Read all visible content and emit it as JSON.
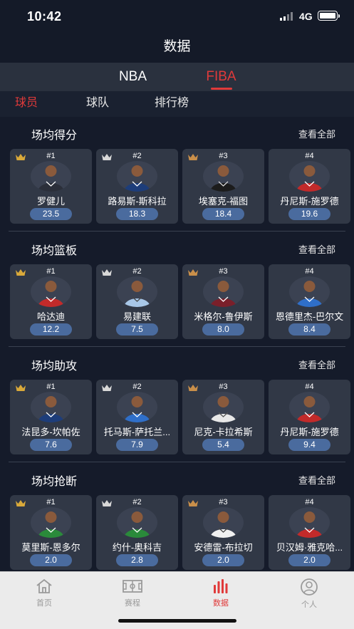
{
  "status": {
    "time": "10:42",
    "network": "4G"
  },
  "header": {
    "title": "数据"
  },
  "league_tabs": [
    {
      "label": "NBA",
      "active": false
    },
    {
      "label": "FIBA",
      "active": true
    }
  ],
  "sub_tabs": [
    {
      "label": "球员",
      "active": true
    },
    {
      "label": "球队",
      "active": false
    },
    {
      "label": "排行榜",
      "active": false
    }
  ],
  "colors": {
    "accent": "#e03a3a",
    "value_pill": "#4a6b9e",
    "card": "#313846",
    "background": "#151b2a"
  },
  "sections": [
    {
      "title": "场均得分",
      "see_all": "查看全部",
      "players": [
        {
          "rank": "#1",
          "crown": "gold",
          "name": "罗健儿",
          "value": "23.5"
        },
        {
          "rank": "#2",
          "crown": "silver",
          "name": "路易斯-斯科拉",
          "value": "18.3"
        },
        {
          "rank": "#3",
          "crown": "bronze",
          "name": "埃塞克-福图",
          "value": "18.4"
        },
        {
          "rank": "#4",
          "crown": "",
          "name": "丹尼斯-施罗德",
          "value": "19.6"
        }
      ]
    },
    {
      "title": "场均篮板",
      "see_all": "查看全部",
      "players": [
        {
          "rank": "#1",
          "crown": "gold",
          "name": "哈达迪",
          "value": "12.2"
        },
        {
          "rank": "#2",
          "crown": "silver",
          "name": "易建联",
          "value": "7.5"
        },
        {
          "rank": "#3",
          "crown": "bronze",
          "name": "米格尔-鲁伊斯",
          "value": "8.0"
        },
        {
          "rank": "#4",
          "crown": "",
          "name": "恩德里杰-巴尔文",
          "value": "8.4"
        }
      ]
    },
    {
      "title": "场均助攻",
      "see_all": "查看全部",
      "players": [
        {
          "rank": "#1",
          "crown": "gold",
          "name": "法昆多-坎帕佐",
          "value": "7.6"
        },
        {
          "rank": "#2",
          "crown": "silver",
          "name": "托马斯-萨托兰...",
          "value": "7.9"
        },
        {
          "rank": "#3",
          "crown": "bronze",
          "name": "尼克-卡拉希斯",
          "value": "5.4"
        },
        {
          "rank": "#4",
          "crown": "",
          "name": "丹尼斯-施罗德",
          "value": "9.4"
        }
      ]
    },
    {
      "title": "场均抢断",
      "see_all": "查看全部",
      "players": [
        {
          "rank": "#1",
          "crown": "gold",
          "name": "莫里斯-恩多尔",
          "value": "2.0"
        },
        {
          "rank": "#2",
          "crown": "silver",
          "name": "约什-奥科吉",
          "value": "2.8"
        },
        {
          "rank": "#3",
          "crown": "bronze",
          "name": "安德雷-布拉切",
          "value": "2.0"
        },
        {
          "rank": "#4",
          "crown": "",
          "name": "贝汉姆·雅克哈...",
          "value": "2.0"
        }
      ]
    }
  ],
  "bottom_tabs": [
    {
      "label": "首页",
      "icon": "home-icon",
      "active": false
    },
    {
      "label": "赛程",
      "icon": "court-icon",
      "active": false
    },
    {
      "label": "数据",
      "icon": "stats-icon",
      "active": true
    },
    {
      "label": "个人",
      "icon": "profile-icon",
      "active": false
    }
  ]
}
